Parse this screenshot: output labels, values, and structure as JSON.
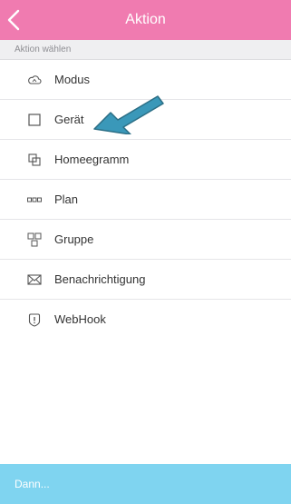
{
  "header": {
    "title": "Aktion",
    "back_icon": "chevron-left-icon",
    "background": "#f07bb0"
  },
  "section": {
    "label": "Aktion wählen"
  },
  "actions": [
    {
      "label": "Modus",
      "icon": "cloud-icon"
    },
    {
      "label": "Gerät",
      "icon": "square-icon"
    },
    {
      "label": "Homeegramm",
      "icon": "overlapping-squares-icon"
    },
    {
      "label": "Plan",
      "icon": "three-squares-icon"
    },
    {
      "label": "Gruppe",
      "icon": "group-icon"
    },
    {
      "label": "Benachrichtigung",
      "icon": "envelope-icon"
    },
    {
      "label": "WebHook",
      "icon": "shield-alert-icon"
    }
  ],
  "annotation": {
    "icon": "arrow-icon",
    "color": "#3a98b9"
  },
  "footer": {
    "label": "Dann...",
    "background": "#7fd4f0"
  }
}
